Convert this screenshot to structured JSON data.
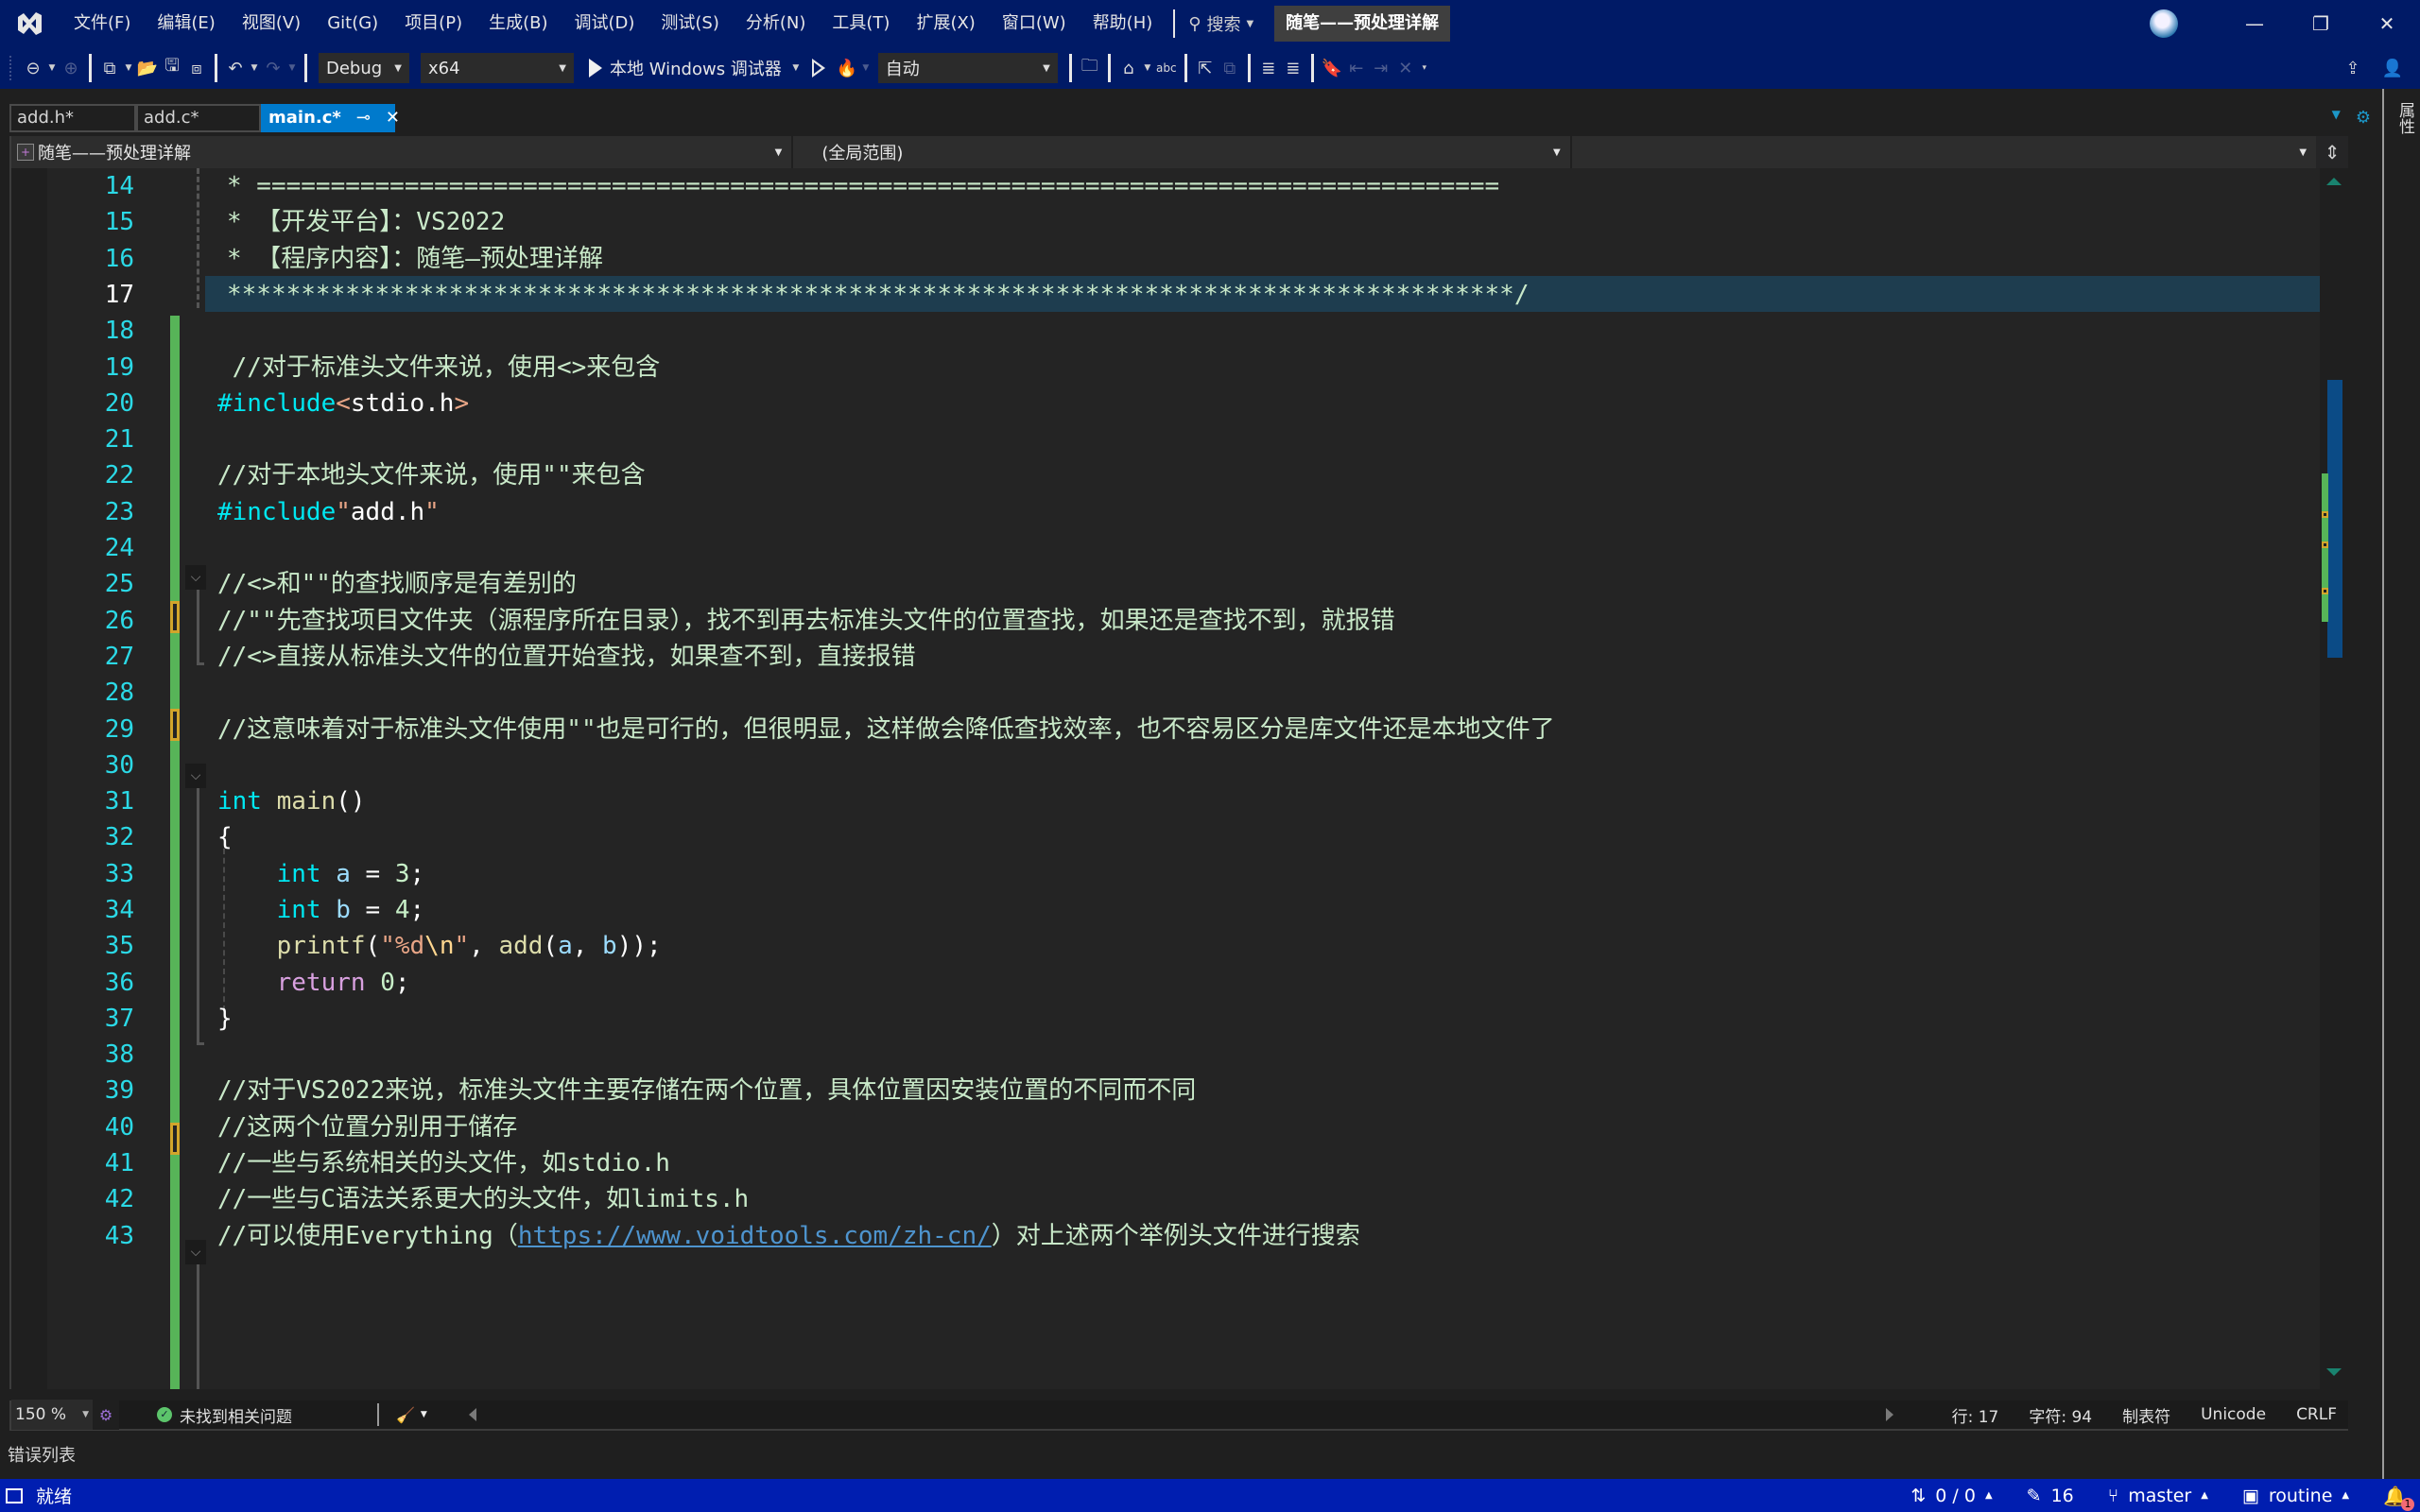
{
  "titlebar": {
    "menu": [
      "文件(F)",
      "编辑(E)",
      "视图(V)",
      "Git(G)",
      "项目(P)",
      "生成(B)",
      "调试(D)",
      "测试(S)",
      "分析(N)",
      "工具(T)",
      "扩展(X)",
      "窗口(W)",
      "帮助(H)"
    ],
    "search_label": "搜索",
    "solution_name": "随笔——预处理详解",
    "minimize": "—",
    "restore": "❐",
    "close": "✕"
  },
  "toolbar": {
    "configuration": "Debug",
    "platform": "x64",
    "run_label": "本地 Windows 调试器",
    "stack_frame": "自动"
  },
  "tabs": [
    {
      "label": "add.h*",
      "active": false
    },
    {
      "label": "add.c*",
      "active": false
    },
    {
      "label": "main.c*",
      "active": true,
      "pin": "⊸",
      "close": "✕"
    }
  ],
  "navbar": {
    "project": "随笔——预处理详解",
    "scope": "(全局范围)",
    "member": ""
  },
  "editor": {
    "current_line": 17,
    "lines": [
      {
        "n": 14,
        "tokens": [
          [
            "cm",
            "* ===================================================================================="
          ]
        ]
      },
      {
        "n": 15,
        "tokens": [
          [
            "cm",
            "* 【开发平台】：VS2022"
          ]
        ]
      },
      {
        "n": 16,
        "tokens": [
          [
            "cm",
            "* 【程序内容】：随笔—预处理详解"
          ]
        ]
      },
      {
        "n": 17,
        "tokens": [
          [
            "cm",
            "***************************************************************************************/"
          ]
        ]
      },
      {
        "n": 18,
        "tokens": []
      },
      {
        "n": 19,
        "tokens": [
          [
            "cm",
            " //对于标准头文件来说，使用<>来包含"
          ]
        ]
      },
      {
        "n": 20,
        "tokens": [
          [
            "pp",
            "#include"
          ],
          [
            "str",
            "<"
          ],
          [
            "plain",
            "stdio.h"
          ],
          [
            "str",
            ">"
          ]
        ]
      },
      {
        "n": 21,
        "tokens": []
      },
      {
        "n": 22,
        "tokens": [
          [
            "cm",
            "//对于本地头文件来说，使用\"\"来包含"
          ]
        ]
      },
      {
        "n": 23,
        "tokens": [
          [
            "pp",
            "#include"
          ],
          [
            "str",
            "\""
          ],
          [
            "plain",
            "add.h"
          ],
          [
            "str",
            "\""
          ]
        ]
      },
      {
        "n": 24,
        "tokens": []
      },
      {
        "n": 25,
        "tokens": [
          [
            "cm",
            "//<>和\"\"的查找顺序是有差别的"
          ]
        ]
      },
      {
        "n": 26,
        "tokens": [
          [
            "cm",
            "//\"\"先查找项目文件夹（源程序所在目录），找不到再去标准头文件的位置查找，如果还是查找不到，就报错"
          ]
        ]
      },
      {
        "n": 27,
        "tokens": [
          [
            "cm",
            "//<>直接从标准头文件的位置开始查找，如果查不到，直接报错"
          ]
        ]
      },
      {
        "n": 28,
        "tokens": []
      },
      {
        "n": 29,
        "tokens": [
          [
            "cm",
            "//这意味着对于标准头文件使用\"\"也是可行的，但很明显，这样做会降低查找效率，也不容易区分是库文件还是本地文件了"
          ]
        ]
      },
      {
        "n": 30,
        "tokens": []
      },
      {
        "n": 31,
        "tokens": [
          [
            "kw",
            "int"
          ],
          [
            "plain",
            " "
          ],
          [
            "fn",
            "main"
          ],
          [
            "plain",
            "()"
          ]
        ]
      },
      {
        "n": 32,
        "tokens": [
          [
            "plain",
            "{"
          ]
        ]
      },
      {
        "n": 33,
        "tokens": [
          [
            "plain",
            "    "
          ],
          [
            "kw",
            "int"
          ],
          [
            "plain",
            " "
          ],
          [
            "var",
            "a"
          ],
          [
            "plain",
            " = "
          ],
          [
            "num",
            "3"
          ],
          [
            "plain",
            ";"
          ]
        ]
      },
      {
        "n": 34,
        "tokens": [
          [
            "plain",
            "    "
          ],
          [
            "kw",
            "int"
          ],
          [
            "plain",
            " "
          ],
          [
            "var",
            "b"
          ],
          [
            "plain",
            " = "
          ],
          [
            "num",
            "4"
          ],
          [
            "plain",
            ";"
          ]
        ]
      },
      {
        "n": 35,
        "tokens": [
          [
            "plain",
            "    "
          ],
          [
            "fn",
            "printf"
          ],
          [
            "plain",
            "("
          ],
          [
            "str",
            "\"%d"
          ],
          [
            "esc",
            "\\n"
          ],
          [
            "str",
            "\""
          ],
          [
            "plain",
            ", "
          ],
          [
            "fn",
            "add"
          ],
          [
            "plain",
            "("
          ],
          [
            "var",
            "a"
          ],
          [
            "plain",
            ", "
          ],
          [
            "var",
            "b"
          ],
          [
            "plain",
            "));"
          ]
        ]
      },
      {
        "n": 36,
        "tokens": [
          [
            "plain",
            "    "
          ],
          [
            "ret",
            "return"
          ],
          [
            "plain",
            " "
          ],
          [
            "num",
            "0"
          ],
          [
            "plain",
            ";"
          ]
        ]
      },
      {
        "n": 37,
        "tokens": [
          [
            "plain",
            "}"
          ]
        ]
      },
      {
        "n": 38,
        "tokens": []
      },
      {
        "n": 39,
        "tokens": [
          [
            "cm",
            "//对于VS2022来说，标准头文件主要存储在两个位置，具体位置因安装位置的不同而不同"
          ]
        ]
      },
      {
        "n": 40,
        "tokens": [
          [
            "cm",
            "//这两个位置分别用于储存"
          ]
        ]
      },
      {
        "n": 41,
        "tokens": [
          [
            "cm",
            "//一些与系统相关的头文件，如stdio.h"
          ]
        ]
      },
      {
        "n": 42,
        "tokens": [
          [
            "cm",
            "//一些与C语法关系更大的头文件，如limits.h"
          ]
        ]
      },
      {
        "n": 43,
        "tokens": [
          [
            "cm",
            "//可以使用Everything（"
          ],
          [
            "link",
            "https://www.voidtools.com/zh-cn/"
          ],
          [
            "cm",
            "）对上述两个举例头文件进行搜索"
          ]
        ]
      }
    ]
  },
  "editor_status": {
    "zoom": "150 %",
    "issues": "未找到相关问题",
    "line": "行: 17",
    "char": "字符: 94",
    "indent": "制表符",
    "encoding": "Unicode",
    "line_ending": "CRLF"
  },
  "panels": {
    "error_list": "错误列表",
    "properties": "属性"
  },
  "statusbar": {
    "ready": "就绪",
    "sync": "0 / 0",
    "changes": "16",
    "branch": "master",
    "repo": "routine",
    "notifications": "1"
  },
  "colors": {
    "title_bg": "#001a66",
    "status_bg": "#001eb0",
    "active_tab": "#007acc",
    "change_bar": "#57b458",
    "line_number": "#2bd9e6"
  }
}
